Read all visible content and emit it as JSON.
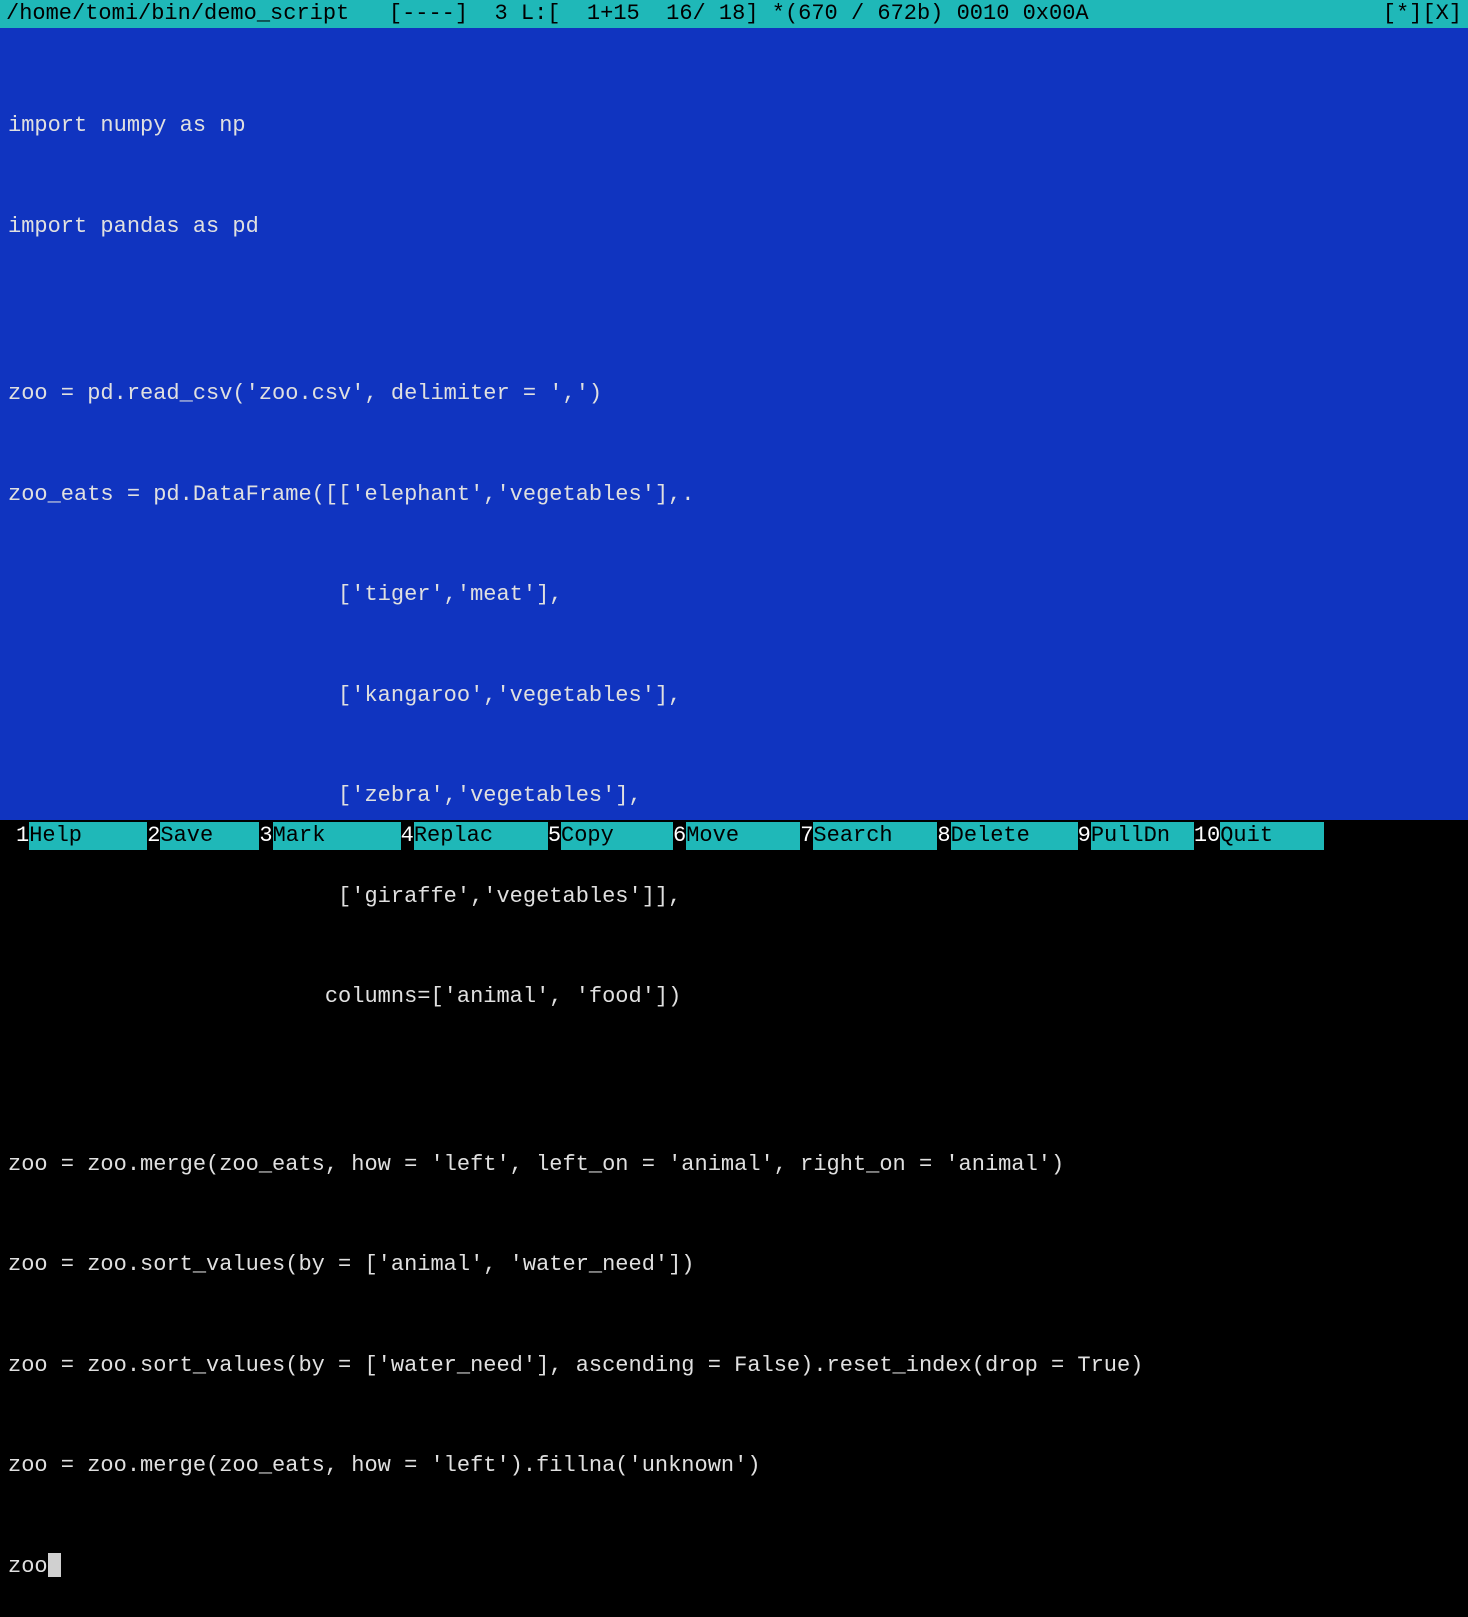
{
  "titleBar": {
    "path": "/home/tomi/bin/demo_script",
    "flags": "[----]",
    "position": "3 L:[  1+15  16/ 18]",
    "bytes": "*(670 / 672b)",
    "codes": "0010 0x00A",
    "modifiedMarker": "[*]",
    "closeMarker": "[X]"
  },
  "code": {
    "lines": [
      "import numpy as np",
      "import pandas as pd",
      "",
      "zoo = pd.read_csv('zoo.csv', delimiter = ',')",
      "zoo_eats = pd.DataFrame([['elephant','vegetables'],.",
      "                         ['tiger','meat'],",
      "                         ['kangaroo','vegetables'],",
      "                         ['zebra','vegetables'],",
      "                         ['giraffe','vegetables']],",
      "                        columns=['animal', 'food'])",
      "",
      "zoo = zoo.merge(zoo_eats, how = 'left', left_on = 'animal', right_on = 'animal')",
      "zoo = zoo.sort_values(by = ['animal', 'water_need'])",
      "zoo = zoo.sort_values(by = ['water_need'], ascending = False).reset_index(drop = True)",
      "zoo = zoo.merge(zoo_eats, how = 'left').fillna('unknown')"
    ],
    "currentLine": "zoo"
  },
  "footer": [
    {
      "num": "1",
      "label": "Help"
    },
    {
      "num": "2",
      "label": "Save"
    },
    {
      "num": "3",
      "label": "Mark"
    },
    {
      "num": "4",
      "label": "Replac"
    },
    {
      "num": "5",
      "label": "Copy"
    },
    {
      "num": "6",
      "label": "Move"
    },
    {
      "num": "7",
      "label": "Search"
    },
    {
      "num": "8",
      "label": "Delete"
    },
    {
      "num": "9",
      "label": "PullDn"
    },
    {
      "num": "10",
      "label": "Quit"
    }
  ]
}
